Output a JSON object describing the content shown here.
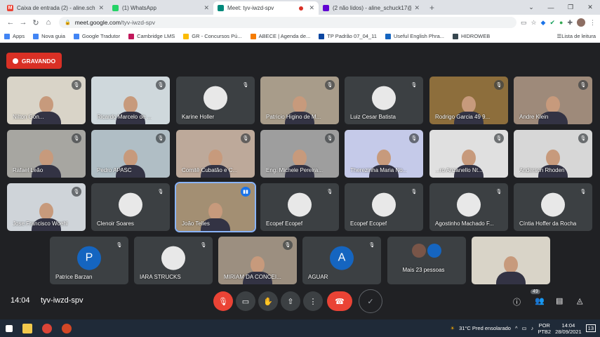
{
  "browser": {
    "tabs": [
      {
        "title": "Caixa de entrada (2) - aline.schuc",
        "fav_color": "#ea4335",
        "fav_letter": "M"
      },
      {
        "title": "(1) WhatsApp",
        "fav_color": "#25d366",
        "fav_letter": ""
      },
      {
        "title": "Meet: tyv-iwzd-spv",
        "fav_color": "#00897b",
        "fav_letter": "",
        "active": true
      },
      {
        "title": "(2 não lidos) - aline_schuck17@y",
        "fav_color": "#6001d2",
        "fav_letter": ""
      }
    ],
    "url_host": "meet.google.com",
    "url_path": "/tyv-iwzd-spv",
    "bookmarks": [
      "Apps",
      "Nova guia",
      "Google Tradutor",
      "Cambridge LMS",
      "GR - Concursos Pú...",
      "ABECE | Agenda de...",
      "TP Padrão 07_04_11",
      "Useful English Phra...",
      "HIDROWEB"
    ],
    "bookmark_colors": [
      "#4285f4",
      "#4285f4",
      "#4285f4",
      "#c2185b",
      "#fbbc05",
      "#f57c00",
      "#0d47a1",
      "#1565c0",
      "#37474f"
    ],
    "reading_list": "Lista de leitura"
  },
  "meet": {
    "recording_label": "GRAVANDO",
    "participants": [
      {
        "name": "Nilton Gon...",
        "bg": "#d9d4c8"
      },
      {
        "name": "Ricardo Marcelo de ...",
        "bg": "#cfd8dc"
      },
      {
        "name": "Karine Holler",
        "bg": "#3c4043"
      },
      {
        "name": "Patricio Higino de M...",
        "bg": "#a89c8a"
      },
      {
        "name": "Luiz Cesar Batista",
        "bg": "#3c4043"
      },
      {
        "name": "Rodrigo Garcia 49 9...",
        "bg": "#8d6e3c"
      },
      {
        "name": "Andre Klein",
        "bg": "#9e8a7a"
      },
      {
        "name": "Rafael Leão",
        "bg": "#a7a6a1"
      },
      {
        "name": "Pedro APASC",
        "bg": "#b0bec5"
      },
      {
        "name": "Comitê Cubatão e C...",
        "bg": "#bda99a"
      },
      {
        "name": "Eng. Michele Pereira...",
        "bg": "#9e9e9e"
      },
      {
        "name": "Therezinha Maria No...",
        "bg": "#c5cae9"
      },
      {
        "name": "...ro Anzanello Nt...",
        "bg": "#e0e0e0"
      },
      {
        "name": "Anderson Rhoden",
        "bg": "#d7d7d7"
      },
      {
        "name": "Jose Francisco Woehl",
        "bg": "#cfd4d9"
      },
      {
        "name": "Clenoir Soares",
        "bg": "#3c4043"
      },
      {
        "name": "João Telles",
        "bg": "#a38f73",
        "speaking": true
      },
      {
        "name": "Ecopef Ecopef",
        "bg": "#3c4043"
      },
      {
        "name": "Ecopef Ecopef",
        "bg": "#3c4043"
      },
      {
        "name": "Agostinho Machado F...",
        "bg": "#3c4043"
      },
      {
        "name": "Cíntia Hoffer da Rocha",
        "bg": "#3c4043"
      },
      {
        "name": "Patrice Barzan",
        "bg": "#3c4043",
        "letter": "P",
        "av_color": "#1565c0"
      },
      {
        "name": "IARA STRUCKS",
        "bg": "#3c4043"
      },
      {
        "name": "MIRIAM DA CONCEI...",
        "bg": "#9c8f80"
      },
      {
        "name": "AGUAR",
        "bg": "#3c4043",
        "letter": "A",
        "av_color": "#1565c0"
      },
      {
        "name": "Mais 23 pessoas",
        "bg": "#3c4043"
      },
      {
        "name": "",
        "bg": "#d9d4c8"
      }
    ],
    "time": "14:04",
    "meeting_code": "tyv-iwzd-spv",
    "participant_count": "49"
  },
  "taskbar": {
    "weather": "31°C  Pred ensolarado",
    "lang": "POR",
    "lang2": "PTB2",
    "clock_time": "14:04",
    "clock_date": "28/09/2021",
    "notif": "13"
  }
}
